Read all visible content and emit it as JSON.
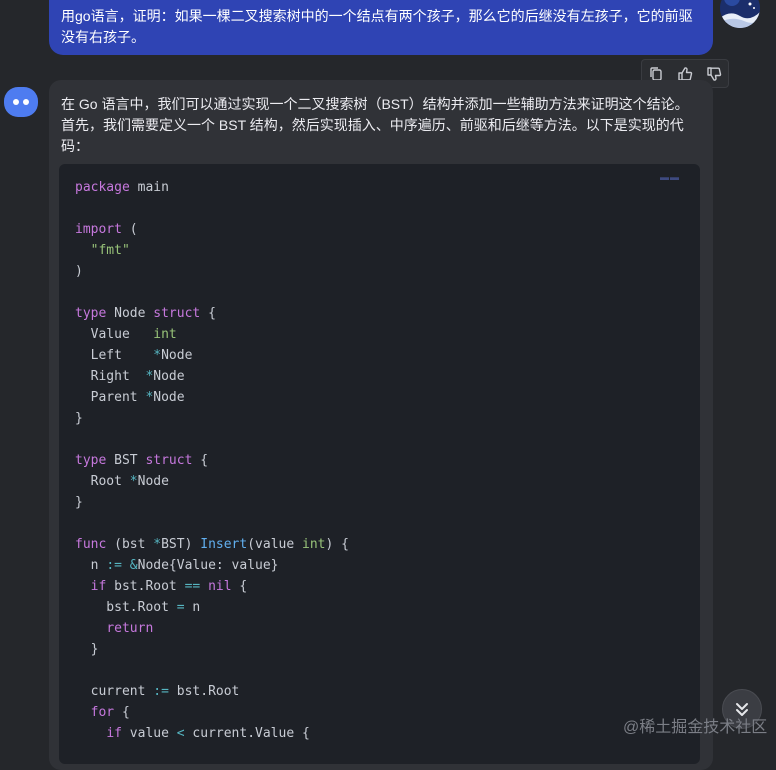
{
  "user_message": {
    "text": "用go语言，证明：如果一棵二叉搜索树中的一个结点有两个孩子，那么它的后继没有左孩子，它的前驱没有右孩子。"
  },
  "user_avatar": {
    "icon": "user-avatar-icon"
  },
  "message_actions": {
    "items": [
      {
        "icon": "copy-icon"
      },
      {
        "icon": "thumbs-up-icon"
      },
      {
        "icon": "thumbs-down-icon"
      }
    ]
  },
  "bot_avatar": {
    "icon": "bot-avatar-icon"
  },
  "answer": {
    "intro": "在 Go 语言中，我们可以通过实现一个二叉搜索树（BST）结构并添加一些辅助方法来证明这个结论。首先，我们需要定义一个 BST 结构，然后实现插入、中序遍历、前驱和后继等方法。以下是实现的代码："
  },
  "code_block": {
    "language": "go",
    "lines": [
      "package main",
      "",
      "import (",
      "  \"fmt\"",
      ")",
      "",
      "type Node struct {",
      "  Value   int",
      "  Left    *Node",
      "  Right  *Node",
      "  Parent *Node",
      "}",
      "",
      "type BST struct {",
      "  Root *Node",
      "}",
      "",
      "func (bst *BST) Insert(value int) {",
      "  n := &Node{Value: value}",
      "  if bst.Root == nil {",
      "    bst.Root = n",
      "    return",
      "  }",
      "",
      "  current := bst.Root",
      "  for {",
      "    if value < current.Value {"
    ]
  },
  "scroll_down_button": {
    "icon": "double-chevron-down-icon"
  },
  "watermark": {
    "text": "@稀土掘金技术社区"
  },
  "colors": {
    "user_bubble": "#2f44b4",
    "bot_panel": "#303237",
    "code_bg": "#1e2127",
    "keyword": "#c678dd",
    "string_type": "#98c379",
    "function": "#61afef"
  }
}
